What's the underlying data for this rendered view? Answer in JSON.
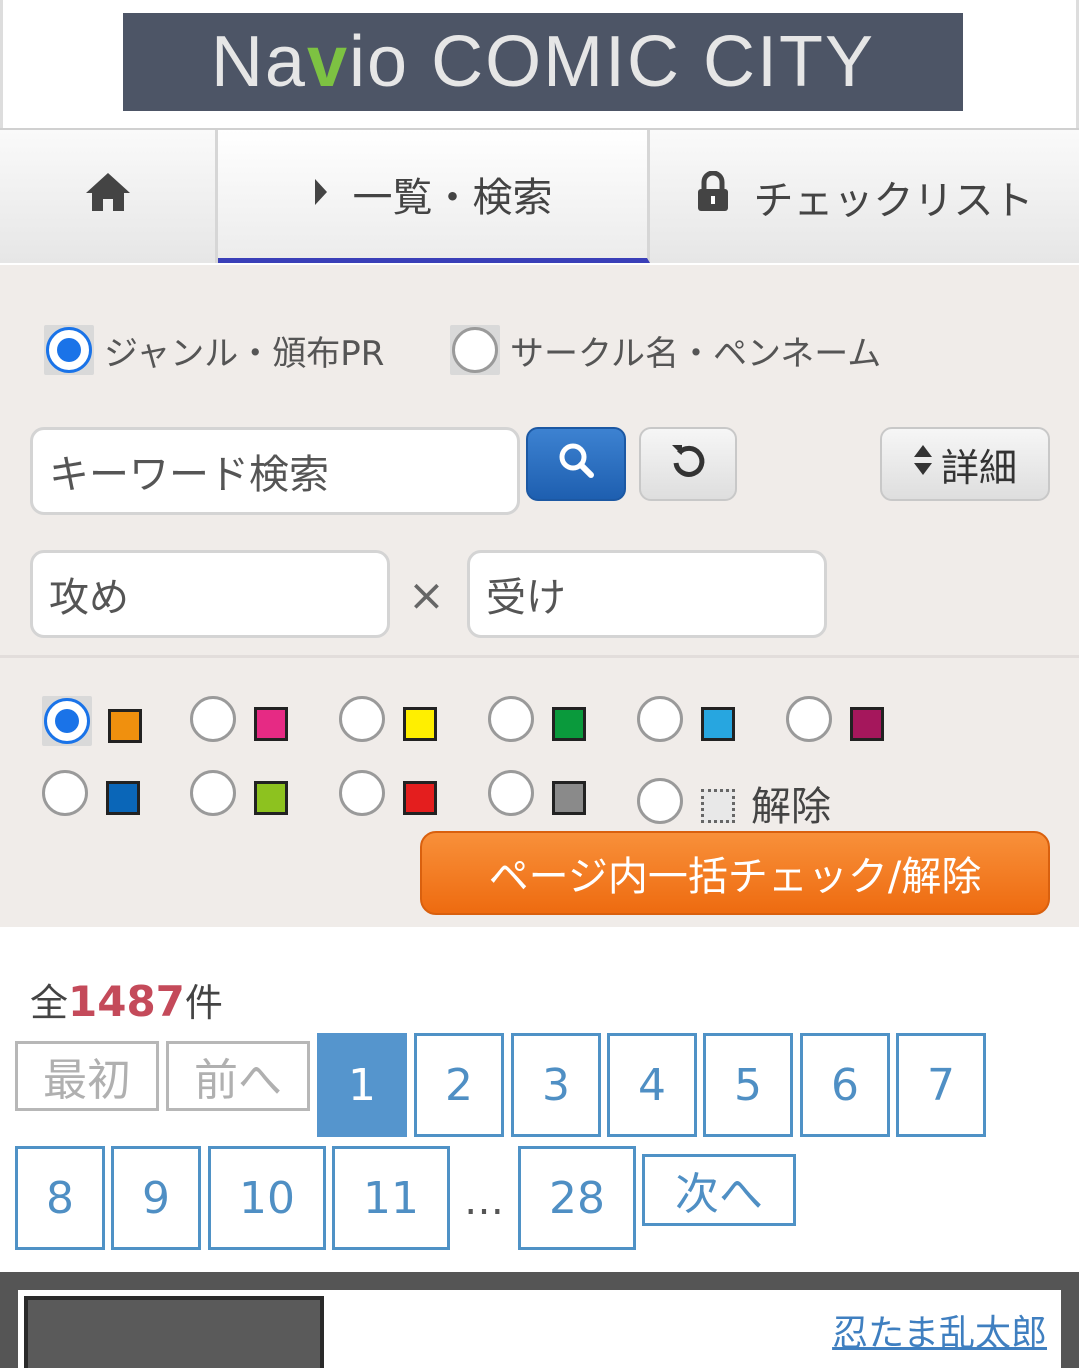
{
  "logo": {
    "text": "Navio  COMIC CITY",
    "part1": "Na",
    "check": "v",
    "part2": "io  COMIC CITY"
  },
  "nav": {
    "home_icon": "home-icon",
    "list_label": "一覧・検索",
    "list_icon": "caret-right-icon",
    "checklist_label": "チェックリスト",
    "checklist_icon": "lock-icon"
  },
  "search": {
    "mode_genre": "ジャンル・頒布PR",
    "mode_circle": "サークル名・ペンネーム",
    "keyword_placeholder": "キーワード検索",
    "search_icon": "search-icon",
    "reset_icon": "refresh-icon",
    "detail_label": "詳細",
    "attack_placeholder": "攻め",
    "times": "×",
    "receive_placeholder": "受け"
  },
  "colors": {
    "items": [
      {
        "color": "#f0900e"
      },
      {
        "color": "#e62a84"
      },
      {
        "color": "#ffef00"
      },
      {
        "color": "#0a9a3c"
      },
      {
        "color": "#27a6e0"
      },
      {
        "color": "#a5175c"
      },
      {
        "color": "#0a66b8"
      },
      {
        "color": "#8dc21f"
      },
      {
        "color": "#e41e1e"
      },
      {
        "color": "#8a8a8a"
      }
    ],
    "clear_label": "解除",
    "bulk_label": "ページ内一括チェック/解除"
  },
  "results": {
    "prefix": "全",
    "total": "1487",
    "suffix": "件"
  },
  "pagination": {
    "first": "最初",
    "prev": "前へ",
    "pages": [
      "1",
      "2",
      "3",
      "4",
      "5",
      "6",
      "7",
      "8",
      "9",
      "10",
      "11"
    ],
    "ellipsis": "…",
    "last": "28",
    "next": "次へ"
  },
  "list": {
    "first_circle_link": "忍たま乱太郎"
  }
}
